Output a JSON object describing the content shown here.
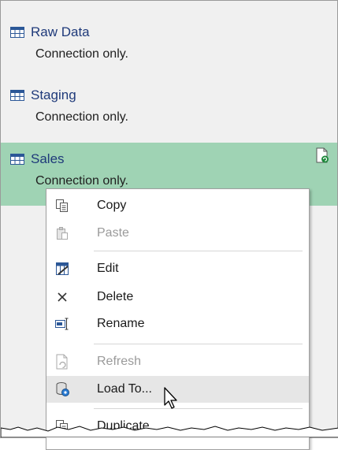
{
  "queries": [
    {
      "name": "Raw Data",
      "status": "Connection only."
    },
    {
      "name": "Staging",
      "status": "Connection only."
    },
    {
      "name": "Sales",
      "status": "Connection only."
    }
  ],
  "context_menu": {
    "items": [
      {
        "label": "Copy",
        "icon": "copy-icon",
        "enabled": true
      },
      {
        "label": "Paste",
        "icon": "paste-icon",
        "enabled": false
      },
      {
        "label": "Edit",
        "icon": "edit-icon",
        "enabled": true
      },
      {
        "label": "Delete",
        "icon": "delete-icon",
        "enabled": true
      },
      {
        "label": "Rename",
        "icon": "rename-icon",
        "enabled": true
      },
      {
        "label": "Refresh",
        "icon": "refresh-icon",
        "enabled": false
      },
      {
        "label": "Load To...",
        "icon": "load-to-icon",
        "enabled": true,
        "hovered": true
      },
      {
        "label": "Duplicate",
        "icon": "duplicate-icon",
        "enabled": true
      }
    ]
  },
  "colors": {
    "selected_row": "#9fd3b4",
    "pane_bg": "#f0f0f0",
    "menu_hover": "#e6e6e6"
  }
}
